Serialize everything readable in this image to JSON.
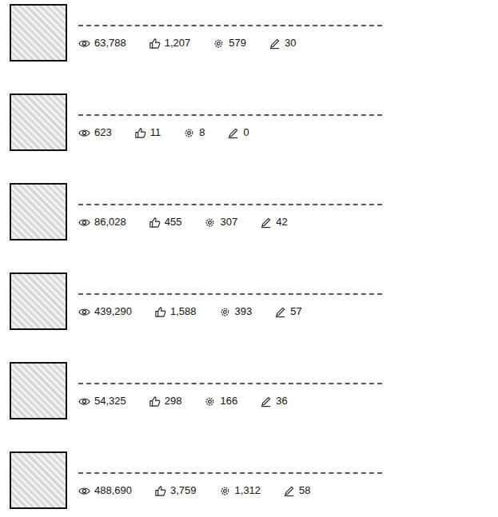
{
  "articles": [
    {
      "views": "63,788",
      "likes": "1,207",
      "favorites": "579",
      "comments": "30"
    },
    {
      "views": "623",
      "likes": "11",
      "favorites": "8",
      "comments": "0"
    },
    {
      "views": "86,028",
      "likes": "455",
      "favorites": "307",
      "comments": "42"
    },
    {
      "views": "439,290",
      "likes": "1,588",
      "favorites": "393",
      "comments": "57"
    },
    {
      "views": "54,325",
      "likes": "298",
      "favorites": "166",
      "comments": "36"
    },
    {
      "views": "488,690",
      "likes": "3,759",
      "favorites": "1,312",
      "comments": "58"
    }
  ]
}
